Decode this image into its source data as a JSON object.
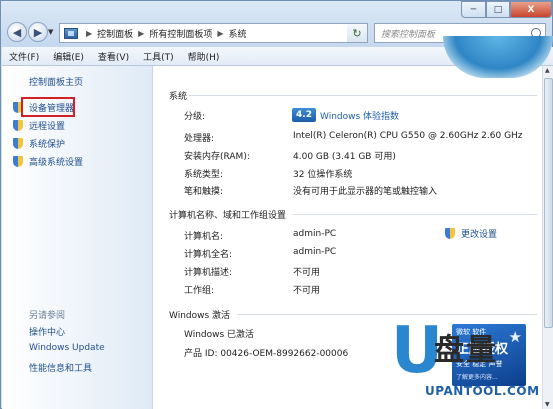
{
  "window": {
    "controls": {
      "minimize": "─",
      "maximize": "□",
      "close": "X"
    },
    "back_glyph": "◀",
    "forward_glyph": "▶",
    "address": {
      "root": "控制面板",
      "crumb2": "所有控制面板项",
      "crumb3": "系统",
      "sep": "▶"
    },
    "refresh_glyph": "↻",
    "search_placeholder": "搜索控制面板"
  },
  "menu": [
    "文件(F)",
    "编辑(E)",
    "查看(V)",
    "工具(T)",
    "帮助(H)"
  ],
  "sidebar": {
    "home": "控制面板主页",
    "tasks": [
      "设备管理器",
      "远程设置",
      "系统保护",
      "高级系统设置"
    ],
    "see_also_title": "另请参阅",
    "see_also": [
      "操作中心",
      "Windows Update",
      "性能信息和工具"
    ]
  },
  "system": {
    "section": "系统",
    "rating_label": "分级:",
    "rating_score": "4.2",
    "rating_link": "Windows 体验指数",
    "processor_label": "处理器:",
    "processor_value": "Intel(R) Celeron(R) CPU G550 @ 2.60GHz   2.60 GHz",
    "ram_label": "安装内存(RAM):",
    "ram_value": "4.00 GB (3.41 GB 可用)",
    "type_label": "系统类型:",
    "type_value": "32 位操作系统",
    "pen_label": "笔和触摸:",
    "pen_value": "没有可用于此显示器的笔或触控输入"
  },
  "computer": {
    "section": "计算机名称、域和工作组设置",
    "name_label": "计算机名:",
    "name_value": "admin-PC",
    "full_label": "计算机全名:",
    "full_value": "admin-PC",
    "desc_label": "计算机描述:",
    "desc_value": "不可用",
    "wg_label": "工作组:",
    "wg_value": "不可用",
    "change_link": "更改设置"
  },
  "activation": {
    "section": "Windows 激活",
    "status": "Windows 已激活",
    "product_id": "产品 ID: 00426-OEM-8992662-00006"
  },
  "badge": {
    "line1": "微软 软件",
    "line2": "正版授权",
    "line3": "安全 稳定 声誉",
    "line4": "了解更多内容..."
  },
  "watermark": {
    "u": "U",
    "cn": "盘量",
    "url": "UPANTOOL.COM"
  },
  "colors": {
    "link": "#1f4f8f",
    "highlight_box": "#d3212a",
    "badge_blue": "#1c5ca8"
  }
}
